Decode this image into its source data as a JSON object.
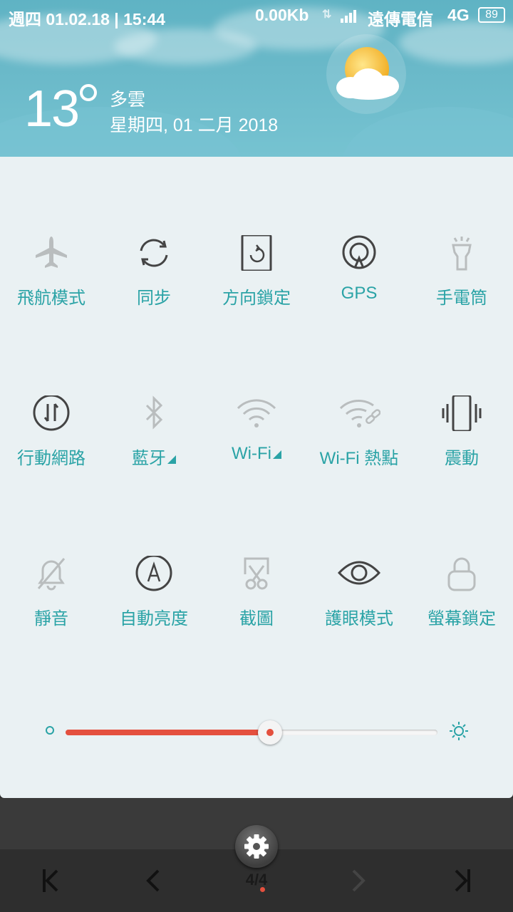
{
  "status": {
    "date_time": "週四 01.02.18 | 15:44",
    "net_speed": "0.00Kb",
    "carrier": "遠傳電信",
    "network": "4G",
    "battery": "89"
  },
  "weather": {
    "temperature": "13",
    "condition": "多雲",
    "date": "星期四, 01 二月 2018"
  },
  "toggles": [
    {
      "label": "飛航模式",
      "icon": "airplane-icon"
    },
    {
      "label": "同步",
      "icon": "sync-icon"
    },
    {
      "label": "方向鎖定",
      "icon": "rotation-lock-icon"
    },
    {
      "label": "GPS",
      "icon": "gps-icon"
    },
    {
      "label": "手電筒",
      "icon": "flashlight-icon"
    },
    {
      "label": "行動網路",
      "icon": "mobile-data-icon"
    },
    {
      "label": "藍牙",
      "icon": "bluetooth-icon"
    },
    {
      "label": "Wi-Fi",
      "icon": "wifi-icon"
    },
    {
      "label": "Wi-Fi 熱點",
      "icon": "hotspot-icon"
    },
    {
      "label": "震動",
      "icon": "vibrate-icon"
    },
    {
      "label": "靜音",
      "icon": "mute-bell-icon"
    },
    {
      "label": "自動亮度",
      "icon": "auto-brightness-icon"
    },
    {
      "label": "截圖",
      "icon": "screenshot-icon"
    },
    {
      "label": "護眼模式",
      "icon": "eye-icon"
    },
    {
      "label": "螢幕鎖定",
      "icon": "lock-icon"
    }
  ],
  "brightness": {
    "level": 0.55
  },
  "pager": {
    "page": "4/4"
  },
  "colors": {
    "accent": "#2aa3a6",
    "slider": "#e4503e",
    "panel": "#eaf1f3"
  }
}
